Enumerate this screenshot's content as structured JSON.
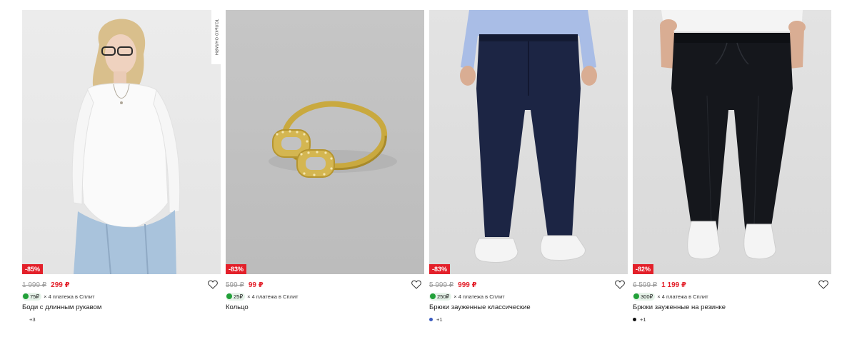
{
  "products": [
    {
      "side_tag": "только онлайн",
      "discount": "-85%",
      "old_price": "1 999 ₽",
      "new_price": "299 ₽",
      "split_cashback": "75₽",
      "split_text": "× 4 платежа в Сплит",
      "title": "Боди с длинным рукавом",
      "swatch_color": "",
      "more_colors": "+3"
    },
    {
      "side_tag": "",
      "discount": "-83%",
      "old_price": "599 ₽",
      "new_price": "99 ₽",
      "split_cashback": "25₽",
      "split_text": "× 4 платежа в Сплит",
      "title": "Кольцо",
      "swatch_color": "",
      "more_colors": ""
    },
    {
      "side_tag": "",
      "discount": "-83%",
      "old_price": "5 999 ₽",
      "new_price": "999 ₽",
      "split_cashback": "250₽",
      "split_text": "× 4 платежа в Сплит",
      "title": "Брюки зауженные классические",
      "swatch_color": "#3a5bbf",
      "more_colors": "+1"
    },
    {
      "side_tag": "",
      "discount": "-82%",
      "old_price": "6 599 ₽",
      "new_price": "1 199 ₽",
      "split_cashback": "300₽",
      "split_text": "× 4 платежа в Сплит",
      "title": "Брюки зауженные на резинке",
      "swatch_color": "#111111",
      "more_colors": "+1"
    }
  ],
  "icons": {
    "wishlist": "heart-outline-icon",
    "split": "split-logo-icon"
  },
  "colors": {
    "accent_red": "#e3202a",
    "split_green": "#21a038"
  }
}
